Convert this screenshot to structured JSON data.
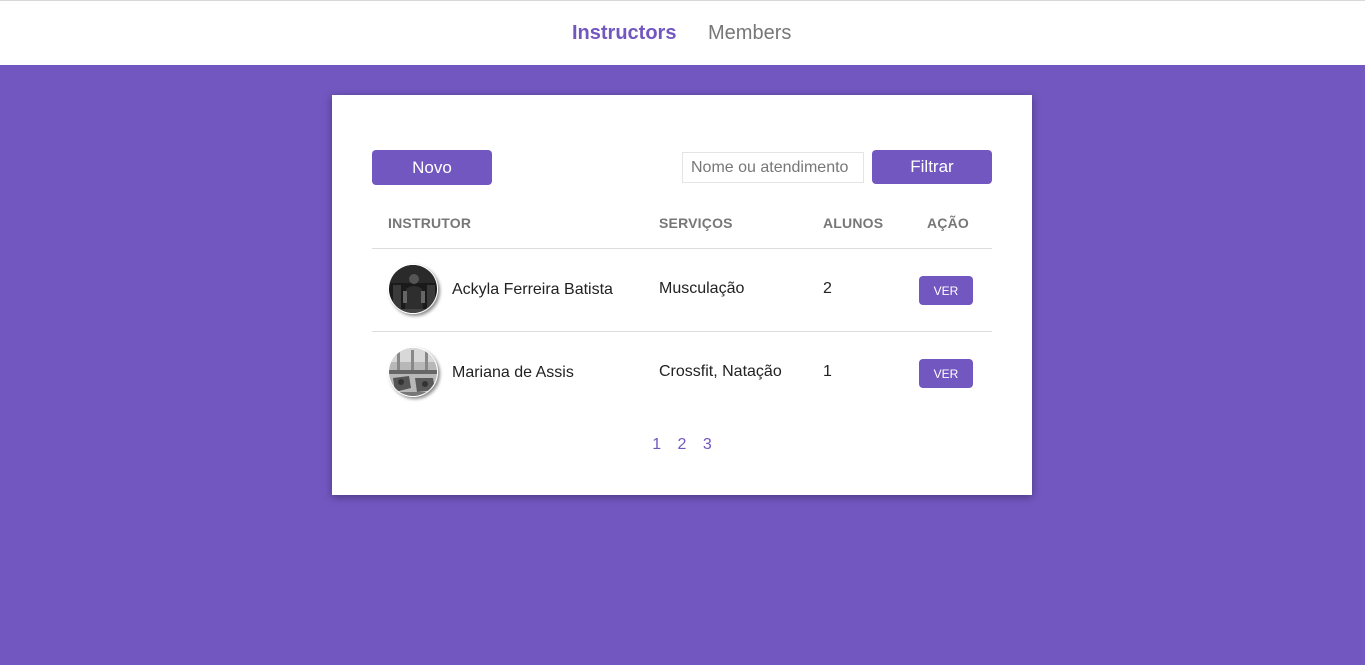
{
  "nav": {
    "items": [
      {
        "label": "Instructors",
        "active": true
      },
      {
        "label": "Members",
        "active": false
      }
    ]
  },
  "toolbar": {
    "new_label": "Novo",
    "search_placeholder": "Nome ou atendimento",
    "filter_label": "Filtrar"
  },
  "table": {
    "headers": [
      "INSTRUTOR",
      "SERVIÇOS",
      "ALUNOS",
      "AÇÃO"
    ],
    "rows": [
      {
        "name": "Ackyla Ferreira Batista",
        "services": "Musculação",
        "students": "2",
        "action": "VER",
        "avatar_icon": "instructor-photo"
      },
      {
        "name": "Mariana de Assis",
        "services": "Crossfit, Natação",
        "students": "1",
        "action": "VER",
        "avatar_icon": "gym-photo"
      }
    ]
  },
  "pagination": {
    "pages": [
      "1",
      "2",
      "3"
    ]
  },
  "colors": {
    "accent": "#7257c0",
    "background": "#7257c0",
    "header_text": "#777777"
  }
}
